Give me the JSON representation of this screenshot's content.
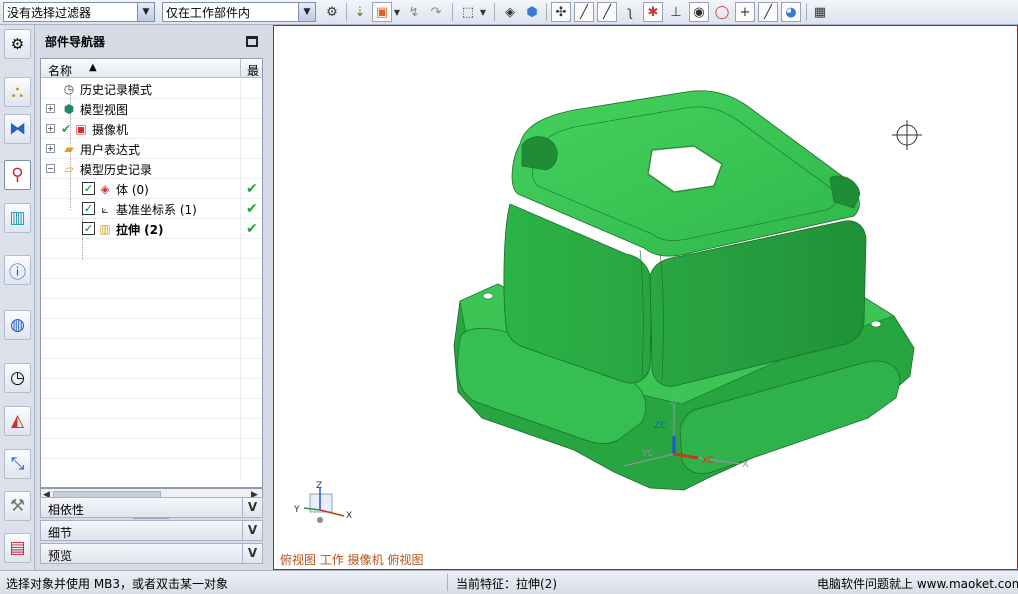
{
  "toolbar": {
    "filter_combo": "没有选择过滤器",
    "scope_combo": "仅在工作部件内"
  },
  "navigator": {
    "title": "部件导航器",
    "columns": {
      "name": "名称",
      "last": "最"
    },
    "rows": [
      {
        "label": "历史记录模式",
        "icon": "clock-icon"
      },
      {
        "label": "模型视图",
        "icon": "model-views-icon"
      },
      {
        "label": "摄像机",
        "icon": "camera-icon"
      },
      {
        "label": "用户表达式",
        "icon": "folder-icon"
      },
      {
        "label": "模型历史记录",
        "icon": "folder-open-icon"
      },
      {
        "label": "体 (0)",
        "icon": "body-icon",
        "checked": true,
        "status": "✔"
      },
      {
        "label": "基准坐标系 (1)",
        "icon": "datum-csys-icon",
        "checked": true,
        "status": "✔"
      },
      {
        "label": "拉伸 (2)",
        "icon": "extrude-icon",
        "checked": true,
        "status": "✔"
      }
    ],
    "panels": [
      {
        "label": "相依性"
      },
      {
        "label": "细节"
      },
      {
        "label": "预览"
      }
    ]
  },
  "viewport": {
    "caption": "俯视图 工作 摄像机 俯视图",
    "triad_labels": {
      "x": "X",
      "y": "Y",
      "z": "Z"
    },
    "csys_labels": {
      "xc": "XC",
      "yc": "YC",
      "zc": "ZC",
      "x": "X",
      "y": "Y",
      "z": "Z"
    }
  },
  "statusbar": {
    "prompt": "选择对象并使用 MB3，或者双击某一对象",
    "feature": "当前特征：拉伸(2)",
    "watermark": "电脑软件问题就上 www.maoket.com"
  },
  "colors": {
    "model_green": "#2fb24a",
    "viewport_border": "#b31a2a",
    "check_green": "#25a33a"
  }
}
